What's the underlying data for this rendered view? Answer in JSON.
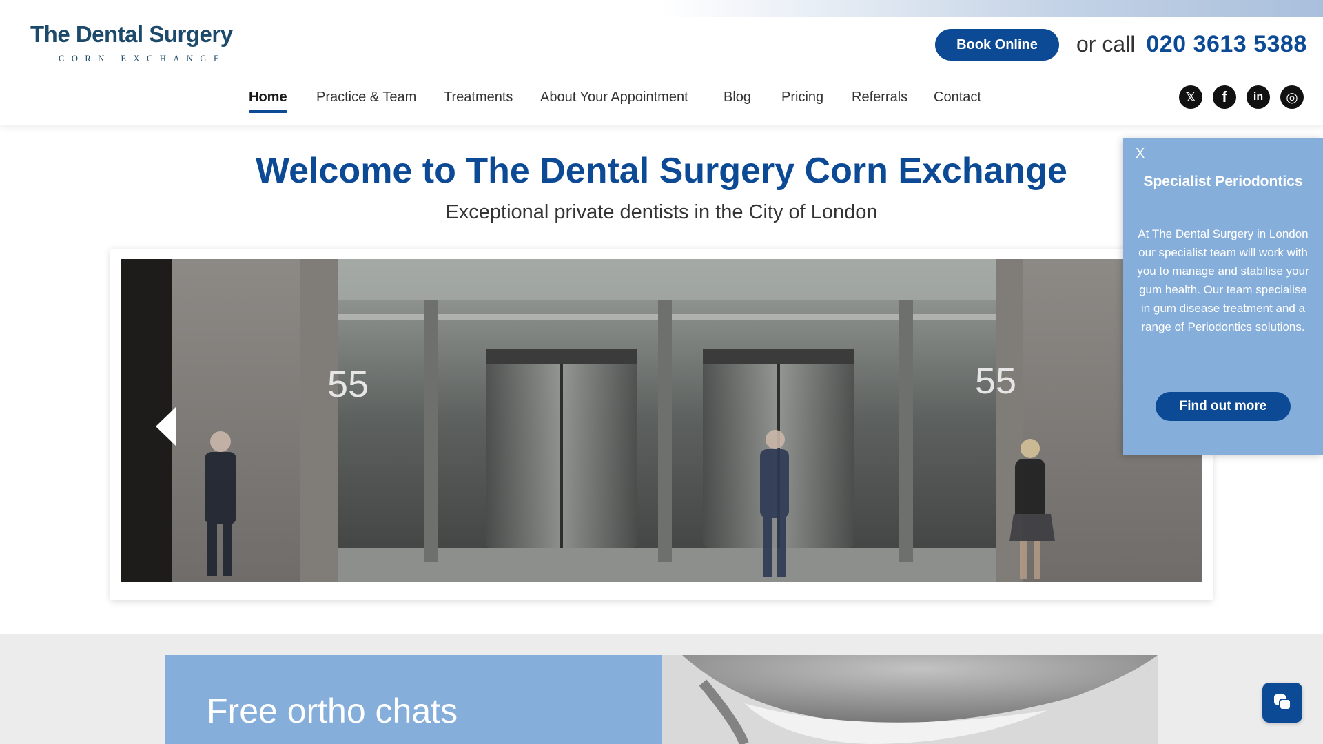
{
  "logo": {
    "title": "The Dental Surgery",
    "subtitle": "CORN EXCHANGE"
  },
  "header": {
    "book_label": "Book Online",
    "call_label": "or call",
    "phone": "020 3613 5388"
  },
  "nav": {
    "items": [
      {
        "label": "Home",
        "active": true
      },
      {
        "label": "Practice & Team"
      },
      {
        "label": "Treatments"
      },
      {
        "label": "About Your Appointment"
      },
      {
        "label": "Blog"
      },
      {
        "label": "Pricing"
      },
      {
        "label": "Referrals"
      },
      {
        "label": "Contact"
      }
    ]
  },
  "social": [
    {
      "icon": "x-icon",
      "glyph": "𝕏"
    },
    {
      "icon": "facebook-icon",
      "glyph": "f"
    },
    {
      "icon": "linkedin-icon",
      "glyph": "in"
    },
    {
      "icon": "instagram-icon",
      "glyph": "◎"
    }
  ],
  "hero": {
    "title": "Welcome to The Dental Surgery Corn Exchange",
    "subtitle": "Exceptional private dentists in the City of London",
    "building_signs": [
      "55",
      "55"
    ]
  },
  "promo": {
    "title": "Free ortho chats"
  },
  "popup": {
    "close_label": "X",
    "title": "Specialist Periodontics",
    "body": "At The Dental Surgery in London our specialist team will work with you to manage and stabilise your gum health. Our team specialise in gum disease treatment and a range of Periodontics solutions.",
    "button_label": "Find out more"
  },
  "colors": {
    "brand": "#0d4a96",
    "light_blue": "#86aedb",
    "logo": "#1d4a6a"
  }
}
